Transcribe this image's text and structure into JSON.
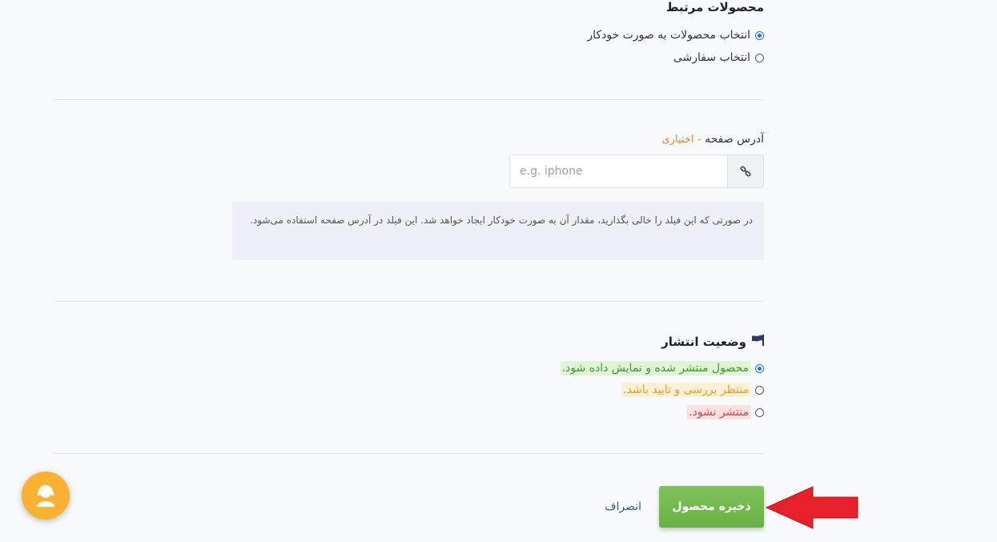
{
  "related_products": {
    "title": "محصولات مرتبط",
    "options": [
      {
        "label": "انتخاب محصولات به صورت خودکار",
        "checked": true
      },
      {
        "label": "انتخاب سفارشی",
        "checked": false
      }
    ]
  },
  "page_address": {
    "label": "آدرس صفحه",
    "separator": "-",
    "optional": "اختیاری",
    "placeholder": "e.g. iphone",
    "value": "",
    "help": "در صورتی که این فیلد را خالی بگذارید، مقدار آن به صورت خودکار ایجاد خواهد شد. این فیلد در آدرس صفحه استفاده می‌شود.",
    "icon": "link-icon"
  },
  "publish_status": {
    "title": "وضعیت انتشار",
    "icon": "flag-icon",
    "options": [
      {
        "label": "محصول منتشر شده و نمایش داده شود.",
        "checked": true,
        "color": "#3d9b2e"
      },
      {
        "label": "منتظر بررسی و تایید باشد.",
        "checked": false,
        "color": "#e39c2a"
      },
      {
        "label": "منتشر نشود.",
        "checked": false,
        "color": "#d04646"
      }
    ]
  },
  "actions": {
    "save_label": "ذخیره محصول",
    "cancel_label": "انصراف"
  },
  "support_widget": {
    "icon": "support-agent-icon",
    "color": "#fbb233"
  },
  "annotation": {
    "arrow_color": "#e8202a"
  }
}
